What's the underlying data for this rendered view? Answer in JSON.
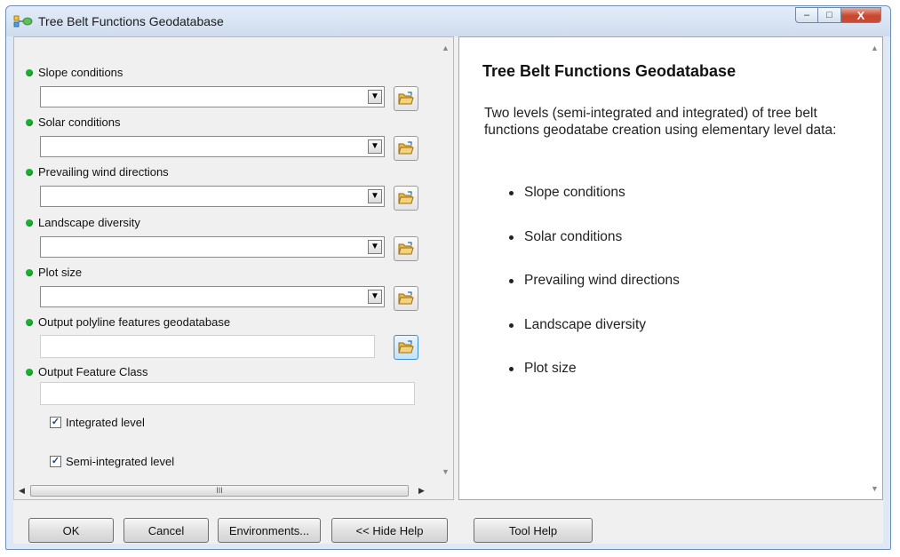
{
  "window": {
    "title": "Tree Belt Functions Geodatabase",
    "controls": {
      "minimize": "–",
      "maximize": "□",
      "close": "X"
    }
  },
  "parameters": [
    {
      "label": "Slope conditions",
      "type": "combo",
      "value": ""
    },
    {
      "label": "Solar conditions",
      "type": "combo",
      "value": ""
    },
    {
      "label": "Prevailing wind directions",
      "type": "combo",
      "value": ""
    },
    {
      "label": "Landscape diversity",
      "type": "combo",
      "value": ""
    },
    {
      "label": "Plot size",
      "type": "combo",
      "value": ""
    },
    {
      "label": "Output polyline features geodatabase",
      "type": "text",
      "value": ""
    },
    {
      "label": "Output Feature Class",
      "type": "text",
      "value": ""
    }
  ],
  "checkboxes": [
    {
      "label": "Integrated level",
      "checked": true
    },
    {
      "label": "Semi-integrated level",
      "checked": true
    }
  ],
  "scrollbar": {
    "thumb_grip": "III"
  },
  "help": {
    "title": "Tree Belt Functions Geodatabase",
    "intro": "Two levels (semi-integrated and integrated) of tree belt functions geodatabe creation using elementary level data:",
    "items": [
      "Slope conditions",
      "Solar conditions",
      "Prevailing wind directions",
      "Landscape diversity",
      "Plot size"
    ]
  },
  "buttons": {
    "ok": "OK",
    "cancel": "Cancel",
    "environments": "Environments...",
    "hide_help": "<< Hide Help",
    "tool_help": "Tool Help"
  },
  "colors": {
    "required_dot": "#18b32d",
    "folder": "#e8b84a",
    "close_button": "#c7462e"
  }
}
